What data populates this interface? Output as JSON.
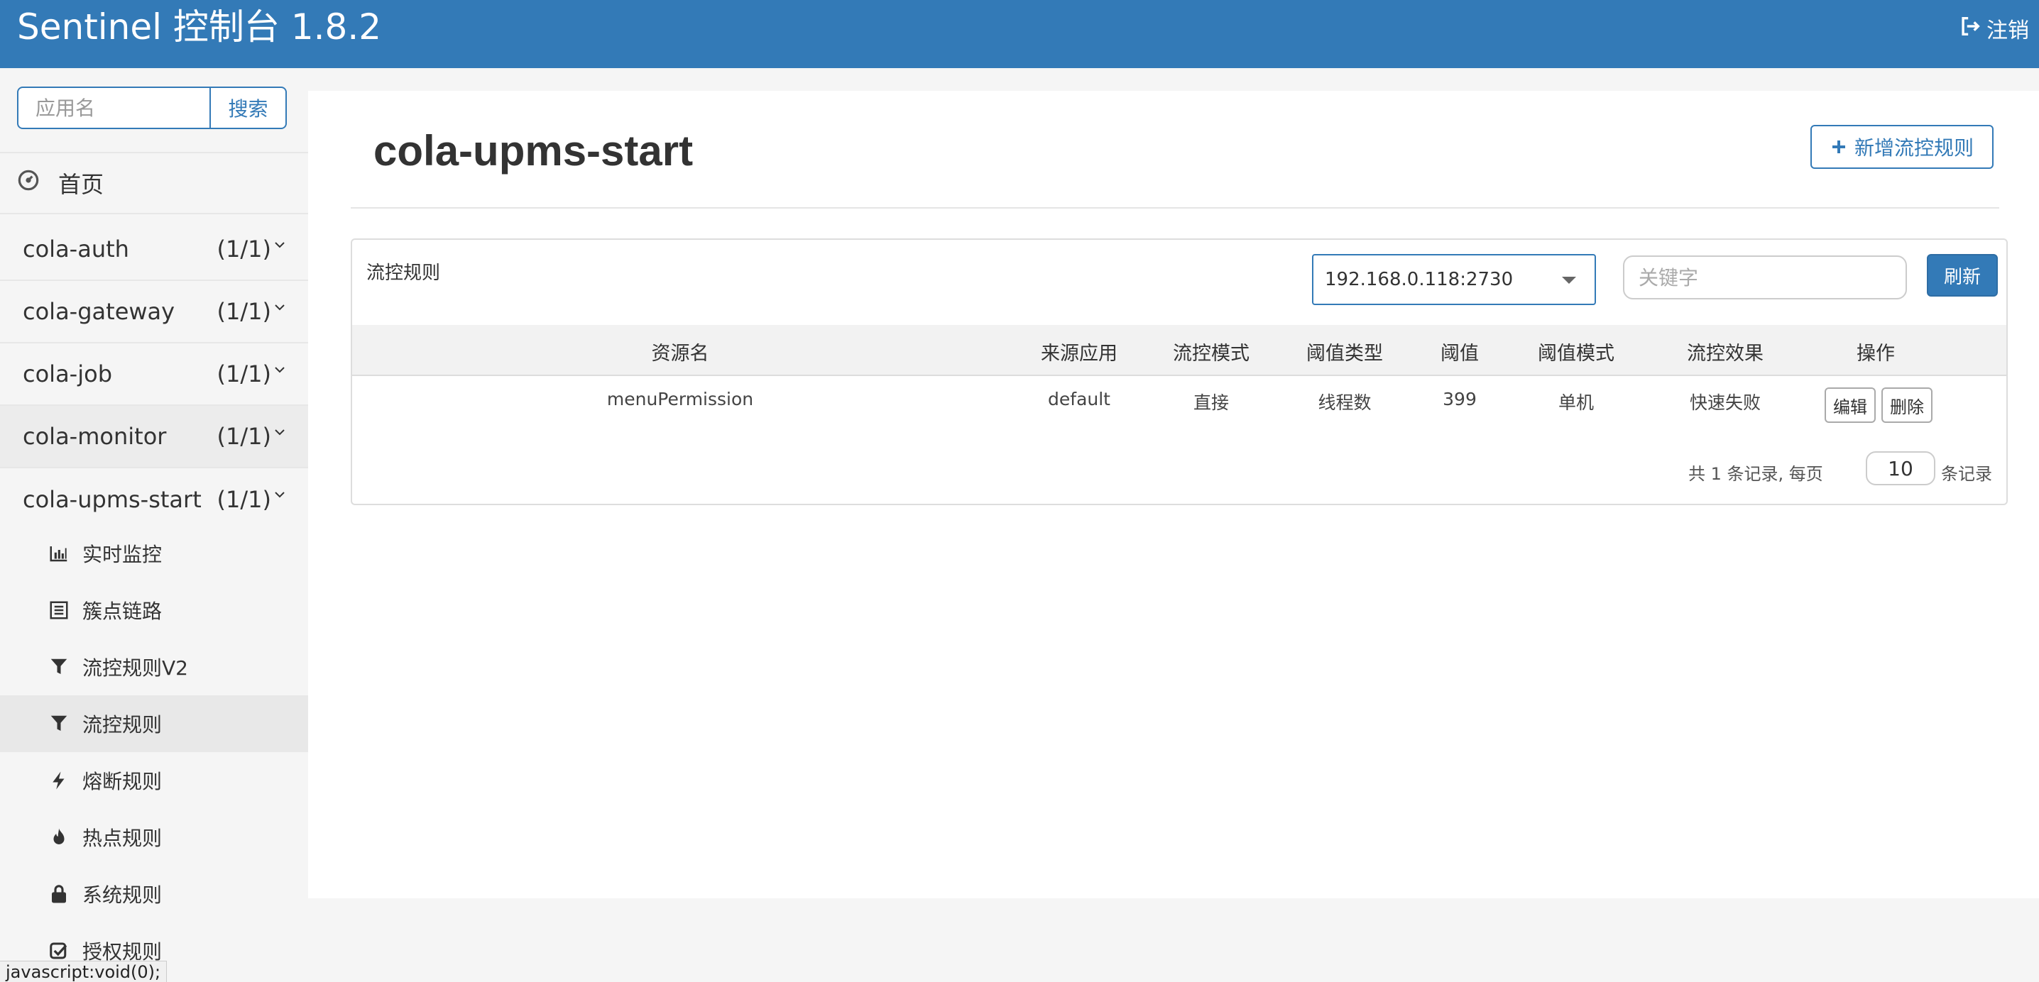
{
  "header": {
    "brand": "Sentinel 控制台 1.8.2",
    "logout_label": "注销"
  },
  "sidebar": {
    "search_placeholder": "应用名",
    "search_button": "搜索",
    "home_label": "首页",
    "apps": [
      {
        "name": "cola-auth",
        "count": "(1/1)"
      },
      {
        "name": "cola-gateway",
        "count": "(1/1)"
      },
      {
        "name": "cola-job",
        "count": "(1/1)"
      },
      {
        "name": "cola-monitor",
        "count": "(1/1)"
      },
      {
        "name": "cola-upms-start",
        "count": "(1/1)"
      }
    ],
    "submenu": [
      {
        "label": "实时监控",
        "icon": "bar-chart-icon"
      },
      {
        "label": "簇点链路",
        "icon": "list-icon"
      },
      {
        "label": "流控规则V2",
        "icon": "filter-icon"
      },
      {
        "label": "流控规则",
        "icon": "filter-icon",
        "active": true
      },
      {
        "label": "熔断规则",
        "icon": "flash-icon"
      },
      {
        "label": "热点规则",
        "icon": "fire-icon"
      },
      {
        "label": "系统规则",
        "icon": "lock-icon"
      },
      {
        "label": "授权规则",
        "icon": "check-square-icon"
      }
    ]
  },
  "status_bar": "javascript:void(0);",
  "main": {
    "title": "cola-upms-start",
    "add_rule_button": "新增流控规则",
    "panel_title": "流控规则",
    "machine_selected": "192.168.0.118:2730",
    "keyword_placeholder": "关键字",
    "refresh_button": "刷新",
    "table": {
      "columns": [
        "资源名",
        "来源应用",
        "流控模式",
        "阈值类型",
        "阈值",
        "阈值模式",
        "流控效果",
        "操作"
      ],
      "rows": [
        {
          "resource": "menuPermission",
          "limit_app": "default",
          "strategy": "直接",
          "grade": "线程数",
          "count": "399",
          "cluster_mode": "单机",
          "control_behavior": "快速失败",
          "edit": "编辑",
          "delete": "删除"
        }
      ]
    },
    "pager": {
      "summary": "共 1 条记录, 每页",
      "page_size": "10",
      "suffix": "条记录"
    }
  },
  "colors": {
    "primary": "#337ab7",
    "sidebar_bg": "#f5f5f5",
    "active_item_bg": "#e8e8e8"
  }
}
